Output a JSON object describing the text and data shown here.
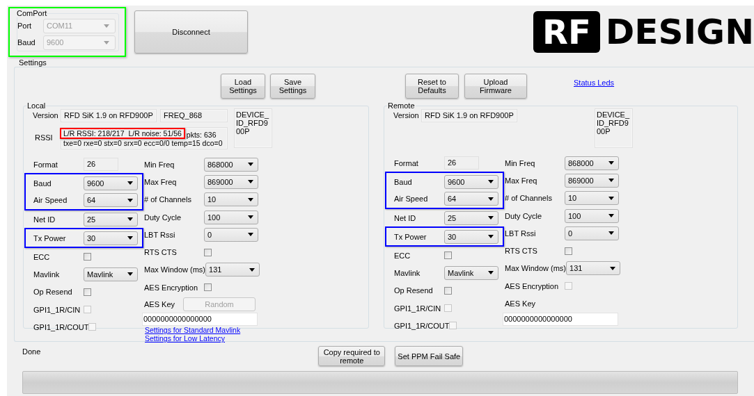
{
  "comport": {
    "title": "ComPort",
    "highlighted": true,
    "fields": [
      {
        "label": "Port",
        "value": "COM11",
        "disabled": true
      },
      {
        "label": "Baud",
        "value": "9600",
        "disabled": true
      }
    ]
  },
  "disconnect_button": "Disconnect",
  "logo": {
    "mark": "RF",
    "word": "DESIGN"
  },
  "settings": {
    "title": "Settings",
    "buttons_left": [
      {
        "label": "Load Settings"
      },
      {
        "label": "Save Settings"
      }
    ],
    "buttons_right": [
      {
        "label": "Reset to Defaults"
      },
      {
        "label": "Upload Firmware"
      }
    ],
    "status_link": "Status Leds"
  },
  "panels": [
    {
      "title": "Local",
      "version_label": "Version",
      "version": "RFD SiK 1.9 on RFD900P",
      "freq": "FREQ_868",
      "device": "DEVICE_ID_RFD900P",
      "rssi": {
        "label": "RSSI",
        "highlighted_text": "L/R RSSI: 218/217  L/R noise: 51/56",
        "rest": "pkts: 636",
        "line2": "txe=0 rxe=0 stx=0 srx=0 ecc=0/0 temp=15 dco=0",
        "highlighted": true
      },
      "left_fields": [
        {
          "kind": "text",
          "label": "Format",
          "value": "26",
          "highlighted": false
        },
        {
          "kind": "combo",
          "label": "Baud",
          "value": "9600",
          "highlighted": true
        },
        {
          "kind": "combo",
          "label": "Air Speed",
          "value": "64",
          "highlighted": true
        },
        {
          "kind": "combo",
          "label": "Net ID",
          "value": "25",
          "highlighted": false
        },
        {
          "kind": "combo",
          "label": "Tx Power",
          "value": "30",
          "highlighted": true
        },
        {
          "kind": "check",
          "label": "ECC",
          "checked": false,
          "disabled": false,
          "highlighted": false
        },
        {
          "kind": "combo",
          "label": "Mavlink",
          "value": "Mavlink",
          "highlighted": false
        },
        {
          "kind": "check",
          "label": "Op Resend",
          "checked": false,
          "disabled": false,
          "highlighted": false
        },
        {
          "kind": "check",
          "label": "GPI1_1R/CIN",
          "checked": false,
          "disabled": true,
          "highlighted": false
        },
        {
          "kind": "check",
          "label": "GPI1_1R/COUT",
          "checked": false,
          "disabled": true,
          "highlighted": false
        }
      ],
      "right_fields": [
        {
          "kind": "combo",
          "label": "Min Freq",
          "value": "868000"
        },
        {
          "kind": "combo",
          "label": "Max Freq",
          "value": "869000"
        },
        {
          "kind": "combo",
          "label": "# of Channels",
          "value": "10"
        },
        {
          "kind": "combo",
          "label": "Duty Cycle",
          "value": "100"
        },
        {
          "kind": "combo",
          "label": "LBT Rssi",
          "value": "0"
        },
        {
          "kind": "check",
          "label": "RTS CTS",
          "checked": false,
          "disabled": false
        },
        {
          "kind": "combo",
          "label": "Max Window (ms)",
          "value": "131"
        },
        {
          "kind": "check",
          "label": "AES Encryption",
          "checked": false,
          "disabled": false
        },
        {
          "kind": "key",
          "label": "AES Key",
          "button": {
            "label": "Random",
            "disabled": true
          },
          "value": "0000000000000000"
        }
      ],
      "links": [
        "Settings for Standard Mavlink",
        "Settings for Low Latency"
      ]
    },
    {
      "title": "Remote",
      "version_label": "Version",
      "version": "RFD SiK 1.9 on RFD900P",
      "device": "DEVICE_ID_RFD900P",
      "left_fields": [
        {
          "kind": "text",
          "label": "Format",
          "value": "26",
          "highlighted": false
        },
        {
          "kind": "combo",
          "label": "Baud",
          "value": "9600",
          "highlighted": true
        },
        {
          "kind": "combo",
          "label": "Air Speed",
          "value": "64",
          "highlighted": true
        },
        {
          "kind": "combo",
          "label": "Net ID",
          "value": "25",
          "highlighted": false
        },
        {
          "kind": "combo",
          "label": "Tx Power",
          "value": "30",
          "highlighted": true
        },
        {
          "kind": "check",
          "label": "ECC",
          "checked": false,
          "disabled": false,
          "highlighted": false
        },
        {
          "kind": "combo",
          "label": "Mavlink",
          "value": "Mavlink",
          "highlighted": false
        },
        {
          "kind": "check",
          "label": "Op Resend",
          "checked": false,
          "disabled": false,
          "highlighted": false
        },
        {
          "kind": "check",
          "label": "GPI1_1R/CIN",
          "checked": false,
          "disabled": true,
          "highlighted": false
        },
        {
          "kind": "check",
          "label": "GPI1_1R/COUT",
          "checked": false,
          "disabled": true,
          "highlighted": false
        }
      ],
      "right_fields": [
        {
          "kind": "combo",
          "label": "Min Freq",
          "value": "868000"
        },
        {
          "kind": "combo",
          "label": "Max Freq",
          "value": "869000"
        },
        {
          "kind": "combo",
          "label": "# of Channels",
          "value": "10"
        },
        {
          "kind": "combo",
          "label": "Duty Cycle",
          "value": "100"
        },
        {
          "kind": "combo",
          "label": "LBT Rssi",
          "value": "0"
        },
        {
          "kind": "check",
          "label": "RTS CTS",
          "checked": false,
          "disabled": false
        },
        {
          "kind": "combo",
          "label": "Max Window (ms)",
          "value": "131"
        },
        {
          "kind": "check",
          "label": "AES Encryption",
          "checked": false,
          "disabled": true
        },
        {
          "kind": "key",
          "label": "AES Key",
          "value": "0000000000000000"
        }
      ]
    }
  ],
  "status": "Done",
  "bottom_buttons": [
    {
      "label": "Copy required to remote"
    },
    {
      "label": "Set PPM Fail Safe"
    }
  ],
  "progress": {
    "level": 0
  }
}
